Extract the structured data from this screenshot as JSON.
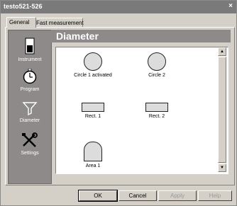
{
  "window": {
    "title": "testo521-526",
    "close": "×"
  },
  "tabs": [
    {
      "label": "General"
    },
    {
      "label": "Fast measurement"
    }
  ],
  "sidebar": {
    "items": [
      {
        "label": "Instrument",
        "icon": "instrument-icon"
      },
      {
        "label": "Program",
        "icon": "stopwatch-icon"
      },
      {
        "label": "Diameter",
        "icon": "funnel-icon"
      },
      {
        "label": "Settings",
        "icon": "tools-icon"
      }
    ]
  },
  "main": {
    "title": "Diameter",
    "shapes": [
      {
        "label": "Circle 1 activated",
        "type": "circle"
      },
      {
        "label": "Circle 2",
        "type": "circle"
      },
      {
        "label": "Rect. 1",
        "type": "rect"
      },
      {
        "label": "Rect. 2",
        "type": "rect"
      },
      {
        "label": "Area 1",
        "type": "area"
      }
    ]
  },
  "buttons": {
    "ok": "OK",
    "cancel": "Cancel",
    "apply": "Apply",
    "help": "Help"
  }
}
